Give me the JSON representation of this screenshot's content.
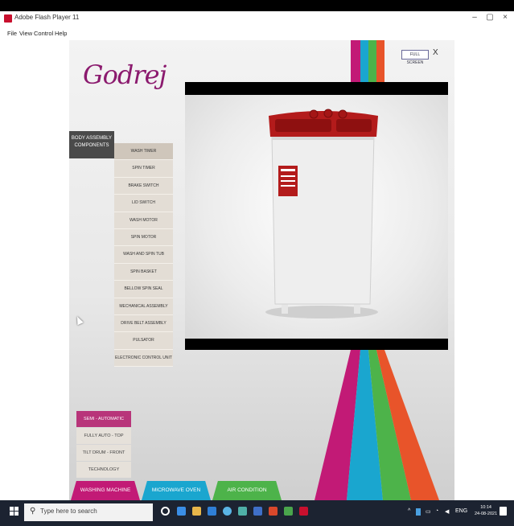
{
  "window": {
    "title": "Adobe Flash Player 11",
    "minimize": "–",
    "maximize": "▢",
    "close": "×"
  },
  "menu": [
    "File",
    "View",
    "Control",
    "Help"
  ],
  "app": {
    "logo": "Godrej",
    "fullscreen_label": "FULL SCREEN",
    "close_label": "X",
    "stripe_colors": [
      "#c21a76",
      "#1aa6cf",
      "#4db34a",
      "#e8542a"
    ],
    "accent": "#b8357a"
  },
  "side_menu": {
    "header": "BODY ASSEMBLY COMPONENTS",
    "items": [
      "WASH TIMER",
      "SPIN TIMER",
      "BRAKE SWITCH",
      "LID SWITCH",
      "WASH MOTOR",
      "SPIN MOTOR",
      "WASH AND SPIN TUB",
      "SPIN BASKET",
      "BELLOW SPIN SEAL",
      "MECHANICAL ASSEMBLY",
      "DRIVE BELT ASSEMBLY",
      "PULSATOR",
      "ELECTRONIC CONTROL UNIT"
    ]
  },
  "categories": [
    {
      "label": "SEMI - AUTOMATIC",
      "active": true
    },
    {
      "label": "FULLY AUTO - TOP",
      "active": false
    },
    {
      "label": "TILT DRUM - FRONT",
      "active": false
    },
    {
      "label": "TECHNOLOGY",
      "active": false
    }
  ],
  "tabs": [
    {
      "label": "WASHING MACHINE",
      "color": "#c21a76"
    },
    {
      "label": "MICROWAVE OVEN",
      "color": "#1aa6cf"
    },
    {
      "label": "AIR CONDITION",
      "color": "#4db34a"
    }
  ],
  "taskbar": {
    "search_placeholder": "Type here to search",
    "language": "ENG",
    "time": "10:14",
    "date": "24-08-2021"
  }
}
